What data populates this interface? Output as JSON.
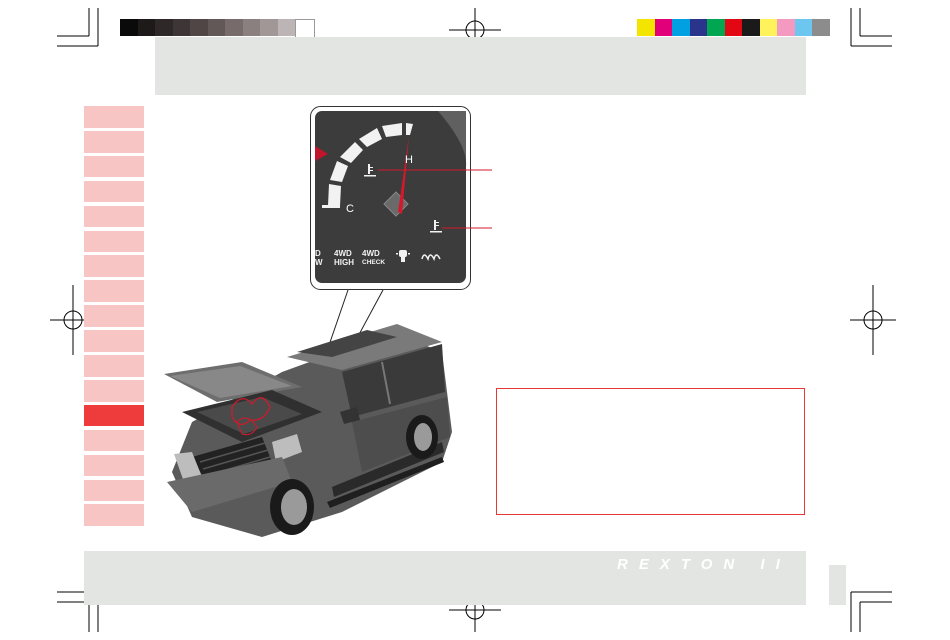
{
  "gauge": {
    "hot_label": "H",
    "cold_label": "C",
    "indicators": [
      {
        "line1": "4WD",
        "line2": "HIGH"
      },
      {
        "line1": "4WD",
        "line2": "CHECK"
      }
    ],
    "partial_indicator": {
      "line1": "D",
      "line2": "W"
    }
  },
  "branding": {
    "logo_text": "REXTON II"
  },
  "colors": {
    "accent_red": "#ee3b3b",
    "tab_pink": "#f8c5c5",
    "band_gray": "#e2e5e2",
    "warning_border": "#e53935"
  },
  "registration_bars": {
    "gray_steps": [
      "#0a0a0a",
      "#1e1a1a",
      "#2e2828",
      "#3e3636",
      "#504646",
      "#635858",
      "#776b6b",
      "#8b8080",
      "#a19797",
      "#bdb5b5",
      "#ffffff"
    ],
    "color_steps": [
      "#f4e500",
      "#e2007a",
      "#00a0e3",
      "#29348a",
      "#00a651",
      "#e30613",
      "#1a1a1a",
      "#fff25a",
      "#f49ac1",
      "#6cc6ef",
      "#8c8c8c"
    ]
  },
  "side_tabs": {
    "count": 17,
    "active_index": 12
  }
}
